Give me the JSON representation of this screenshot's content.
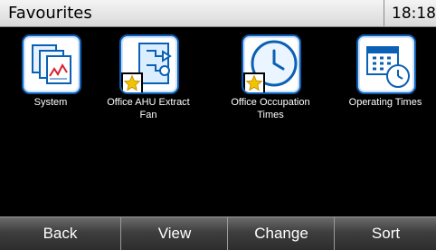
{
  "header": {
    "title": "Favourites",
    "time": "18:18"
  },
  "tiles": [
    {
      "label": "System"
    },
    {
      "label": "Office AHU Extract Fan"
    },
    {
      "label": "Office Occupation Times"
    },
    {
      "label": "Operating Times"
    }
  ],
  "buttons": {
    "back": "Back",
    "view": "View",
    "change": "Change",
    "sort": "Sort"
  },
  "icons": [
    "system-icon",
    "ahu-fan-icon",
    "clock-icon",
    "calendar-clock-icon",
    "favourite-star-icon"
  ],
  "colors": {
    "accent": "#0b60b5",
    "star": "#f2c400"
  }
}
